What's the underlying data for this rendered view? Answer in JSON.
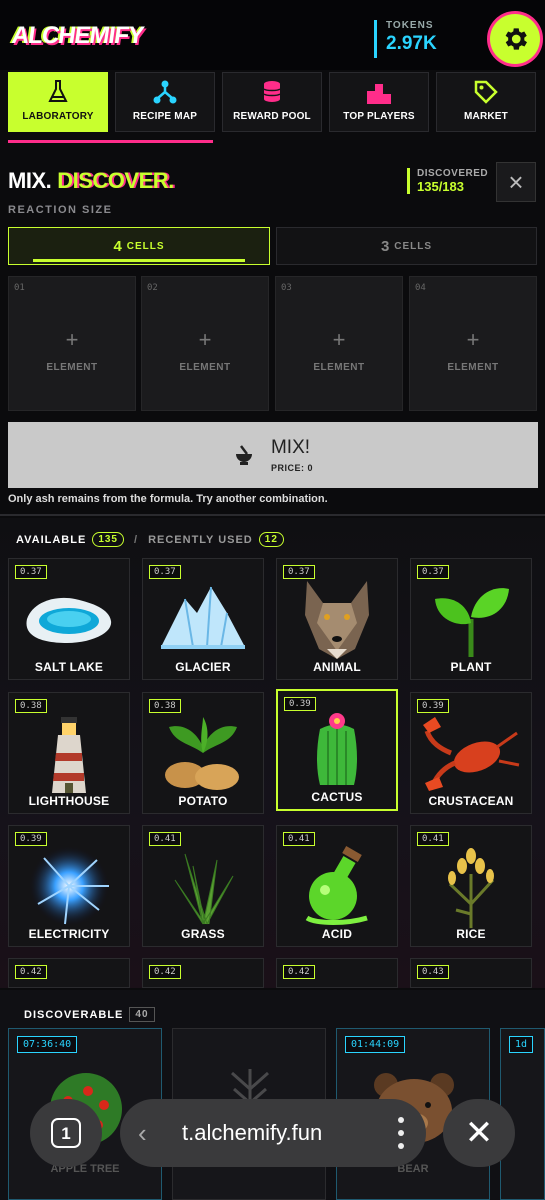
{
  "header": {
    "logo": "ALCHEMIFY",
    "tokens_label": "TOKENS",
    "tokens_value": "2.97K",
    "settings_icon": "gear-icon"
  },
  "tabs": [
    {
      "label": "LABORATORY",
      "icon": "flask-icon",
      "active": true
    },
    {
      "label": "RECIPE MAP",
      "icon": "nodes-icon",
      "active": false
    },
    {
      "label": "REWARD POOL",
      "icon": "coins-icon",
      "active": false
    },
    {
      "label": "TOP PLAYERS",
      "icon": "podium-icon",
      "active": false
    },
    {
      "label": "MARKET",
      "icon": "tag-icon",
      "active": false
    }
  ],
  "mix": {
    "title_a": "MIX.",
    "title_b": "DISCOVER.",
    "reaction_label": "REACTION SIZE",
    "discovered_label": "DISCOVERED",
    "discovered_value": "135/183",
    "sizes": [
      {
        "num": "4",
        "label": "CELLS",
        "active": true
      },
      {
        "num": "3",
        "label": "CELLS",
        "active": false
      }
    ],
    "cells": [
      {
        "num": "01",
        "plus": "+",
        "label": "ELEMENT"
      },
      {
        "num": "02",
        "plus": "+",
        "label": "ELEMENT"
      },
      {
        "num": "03",
        "plus": "+",
        "label": "ELEMENT"
      },
      {
        "num": "04",
        "plus": "+",
        "label": "ELEMENT"
      }
    ],
    "mix_button": "MIX!",
    "price": "PRICE: 0",
    "message": "Only ash remains from the formula. Try another combination."
  },
  "available": {
    "label": "AVAILABLE",
    "count": "135",
    "separator": "/",
    "recent_label": "RECENTLY USED",
    "recent_count": "12",
    "items": [
      {
        "name": "SALT LAKE",
        "price": "0.37",
        "icon": "salt-lake-icon"
      },
      {
        "name": "GLACIER",
        "price": "0.37",
        "icon": "glacier-icon"
      },
      {
        "name": "ANIMAL",
        "price": "0.37",
        "icon": "wolf-icon"
      },
      {
        "name": "PLANT",
        "price": "0.37",
        "icon": "sprout-icon"
      },
      {
        "name": "LIGHTHOUSE",
        "price": "0.38",
        "icon": "lighthouse-icon"
      },
      {
        "name": "POTATO",
        "price": "0.38",
        "icon": "potato-icon"
      },
      {
        "name": "CACTUS",
        "price": "0.39",
        "icon": "cactus-icon",
        "selected": true
      },
      {
        "name": "CRUSTACEAN",
        "price": "0.39",
        "icon": "lobster-icon"
      },
      {
        "name": "ELECTRICITY",
        "price": "0.39",
        "icon": "lightning-icon"
      },
      {
        "name": "GRASS",
        "price": "0.41",
        "icon": "grass-icon"
      },
      {
        "name": "ACID",
        "price": "0.41",
        "icon": "acid-flask-icon"
      },
      {
        "name": "RICE",
        "price": "0.41",
        "icon": "rice-icon"
      },
      {
        "name": "",
        "price": "0.42",
        "icon": ""
      },
      {
        "name": "",
        "price": "0.42",
        "icon": ""
      },
      {
        "name": "",
        "price": "0.42",
        "icon": ""
      },
      {
        "name": "",
        "price": "0.43",
        "icon": ""
      }
    ]
  },
  "discoverable": {
    "label": "DISCOVERABLE",
    "count": "40",
    "items": [
      {
        "timer": "07:36:40",
        "name": "APPLE TREE",
        "icon": "apple-tree-icon"
      },
      {
        "timer": "",
        "name": "",
        "icon": "wheat-icon"
      },
      {
        "timer": "01:44:09",
        "name": "BEAR",
        "icon": "bear-icon"
      },
      {
        "timer": "1d",
        "name": "",
        "icon": ""
      }
    ]
  },
  "browser": {
    "tab_count": "1",
    "back": "‹",
    "url": "t.alchemify.fun",
    "close": "✕"
  },
  "colors": {
    "accent_lime": "#c8ff2e",
    "accent_pink": "#ff2d8a",
    "accent_cyan": "#2ad4ff"
  }
}
